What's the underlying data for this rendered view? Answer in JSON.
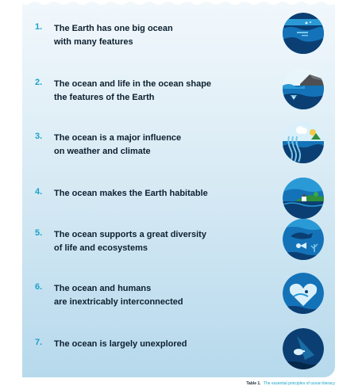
{
  "principles": [
    {
      "number": "1.",
      "lines": [
        "The Earth has one big ocean",
        "with many features"
      ],
      "icon": "globe-ocean-features-icon"
    },
    {
      "number": "2.",
      "lines": [
        "The ocean and life in the ocean shape",
        "the features of the Earth"
      ],
      "icon": "coastline-shaping-icon"
    },
    {
      "number": "3.",
      "lines": [
        "The ocean is a major influence",
        "on weather and climate"
      ],
      "icon": "weather-climate-icon"
    },
    {
      "number": "4.",
      "lines": [
        "The ocean makes the Earth habitable"
      ],
      "icon": "habitable-earth-icon"
    },
    {
      "number": "5.",
      "lines": [
        "The ocean supports a great diversity",
        "of life and ecosystems"
      ],
      "icon": "marine-biodiversity-icon"
    },
    {
      "number": "6.",
      "lines": [
        "The ocean and humans",
        "are inextricably interconnected"
      ],
      "icon": "heart-ocean-humans-icon"
    },
    {
      "number": "7.",
      "lines": [
        "The ocean is largely unexplored"
      ],
      "icon": "deep-sea-exploration-icon"
    }
  ],
  "caption": {
    "label": "Table 1.",
    "text": "The essential principles of ocean literacy"
  },
  "colors": {
    "accent": "#1aa3c8",
    "text": "#0d2030",
    "panel_top": "#f2f8fc",
    "panel_bottom": "#b6d9ec",
    "icon_dark": "#0b3f73",
    "icon_mid": "#1473b8",
    "icon_light": "#2a9ad6"
  }
}
